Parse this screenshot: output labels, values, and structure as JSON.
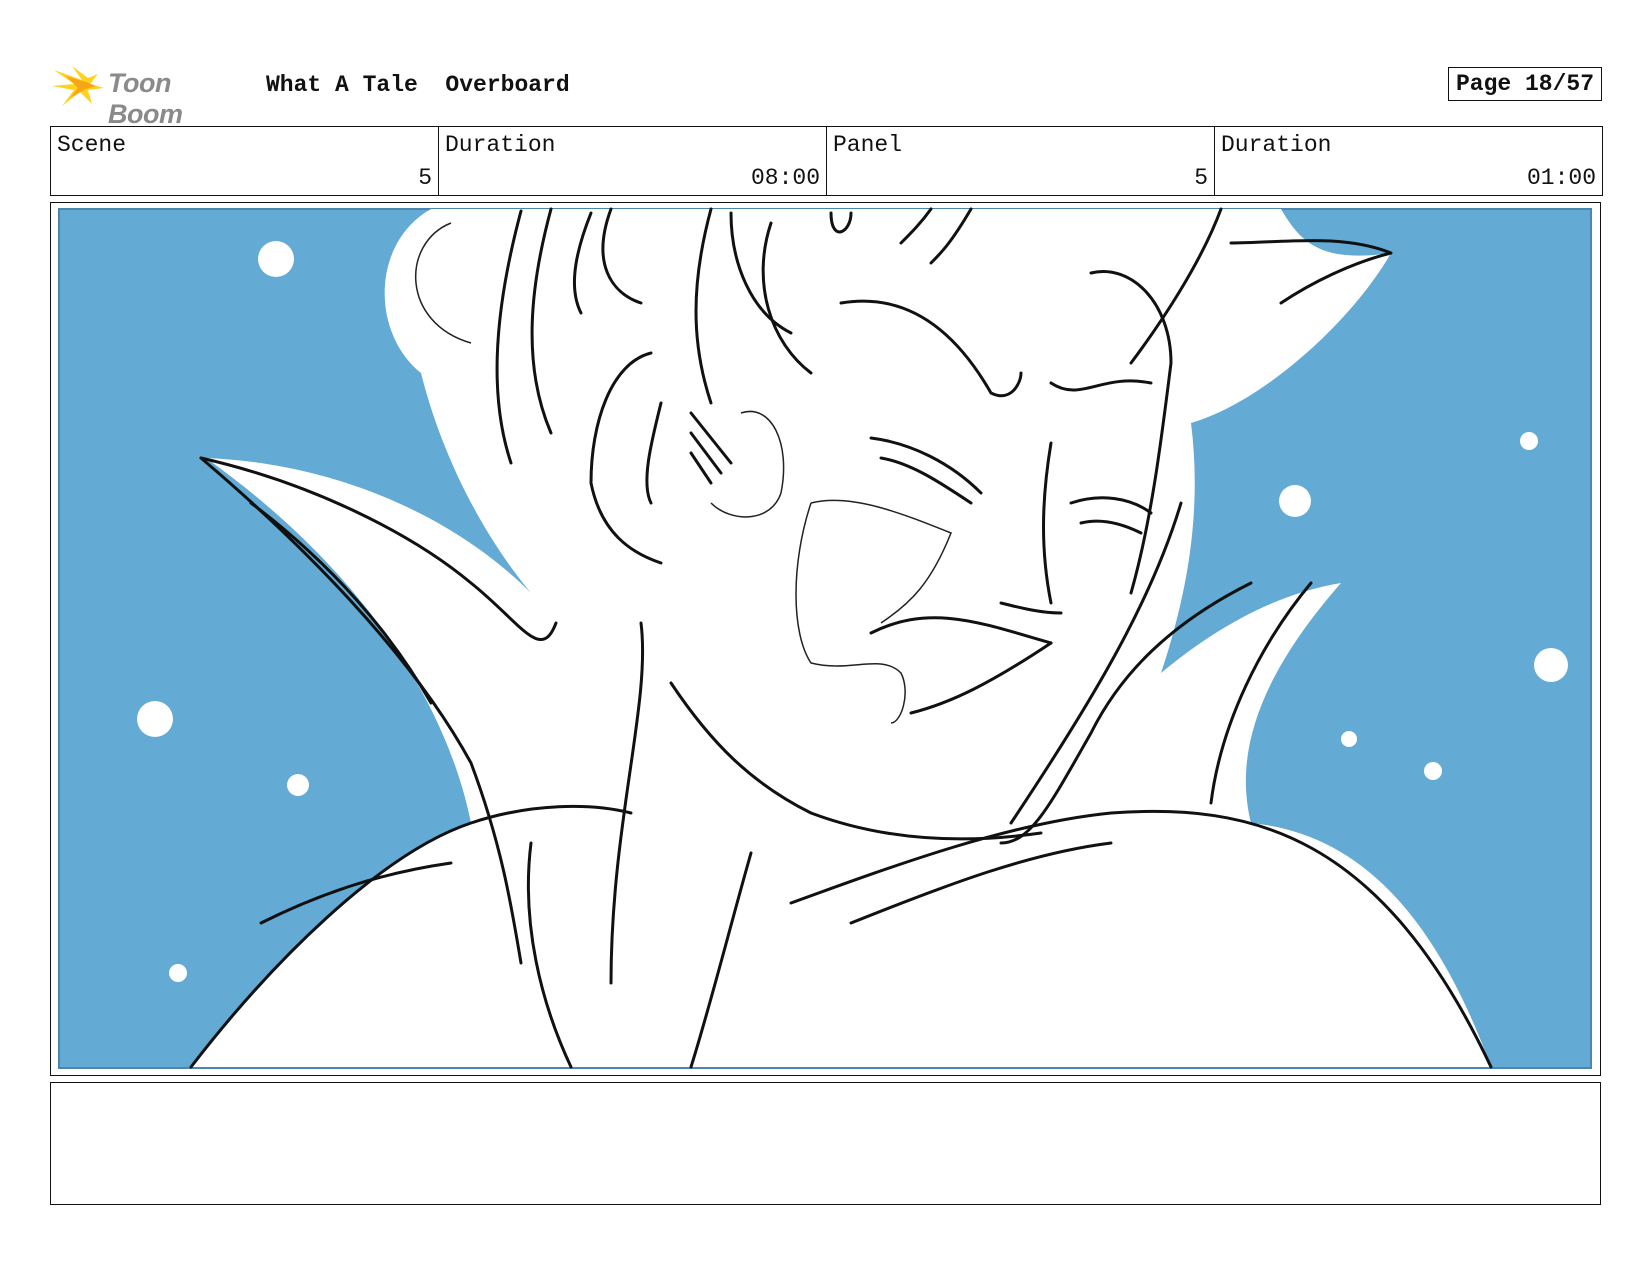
{
  "header": {
    "logo_text": "Toon Boom",
    "project": "What A Tale  Overboard",
    "page": "Page 18/57"
  },
  "info": {
    "scene_label": "Scene",
    "scene_value": "5",
    "scene_duration_label": "Duration",
    "scene_duration_value": "08:00",
    "panel_label": "Panel",
    "panel_value": "5",
    "panel_duration_label": "Duration",
    "panel_duration_value": "01:00"
  },
  "notes": {
    "text": ""
  },
  "colors": {
    "sky": "#63aad5",
    "line": "#111111",
    "logo_orange": "#f5a516",
    "logo_yellow": "#ffd21e"
  }
}
